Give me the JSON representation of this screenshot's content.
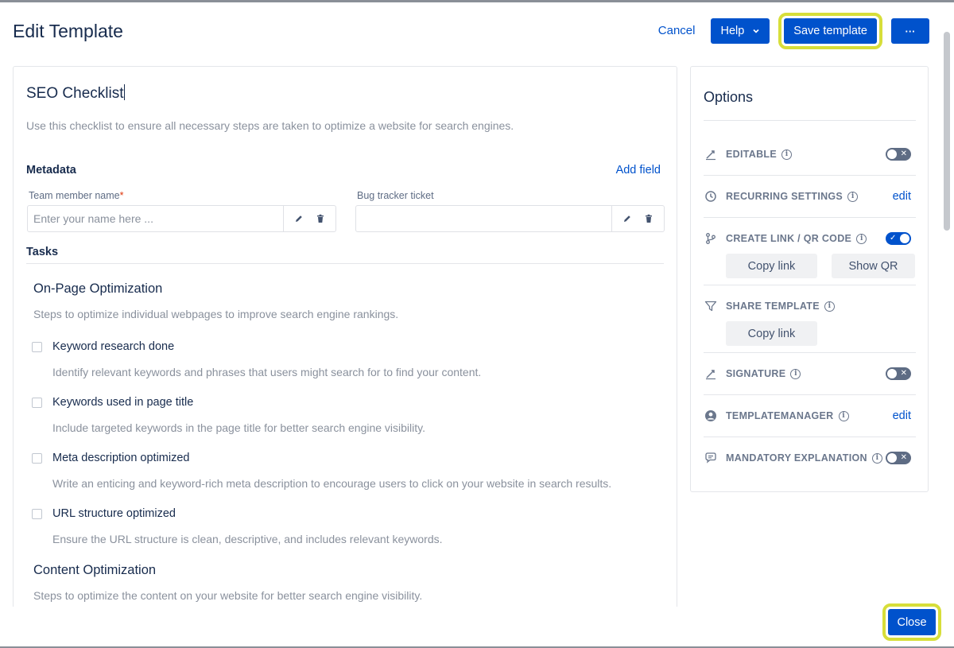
{
  "header": {
    "title": "Edit Template",
    "cancel_label": "Cancel",
    "help_label": "Help",
    "save_label": "Save template",
    "more_label": "···"
  },
  "checklist": {
    "title": "SEO Checklist",
    "description": "Use this checklist to ensure all necessary steps are taken to optimize a website for search engines."
  },
  "metadata": {
    "label": "Metadata",
    "add_field_label": "Add field",
    "fields": [
      {
        "label": "Team member name",
        "required_mark": "*",
        "placeholder": "Enter your name here ...",
        "value": ""
      },
      {
        "label": "Bug tracker ticket",
        "placeholder": "",
        "value": ""
      }
    ]
  },
  "tasks": {
    "label": "Tasks",
    "groups": [
      {
        "title": "On-Page Optimization",
        "description": "Steps to optimize individual webpages to improve search engine rankings.",
        "items": [
          {
            "name": "Keyword research done",
            "description": "Identify relevant keywords and phrases that users might search for to find your content."
          },
          {
            "name": "Keywords used in page title",
            "description": "Include targeted keywords in the page title for better search engine visibility."
          },
          {
            "name": "Meta description optimized",
            "description": "Write an enticing and keyword-rich meta description to encourage users to click on your website in search results."
          },
          {
            "name": "URL structure optimized",
            "description": "Ensure the URL structure is clean, descriptive, and includes relevant keywords."
          }
        ]
      },
      {
        "title": "Content Optimization",
        "description": "Steps to optimize the content on your website for better search engine visibility."
      }
    ]
  },
  "options": {
    "title": "Options",
    "info_glyph": "i",
    "toggle_off_mark": "✕",
    "toggle_on_mark": "✓",
    "edit_label": "edit",
    "rows": {
      "editable": {
        "label": "EDITABLE",
        "enabled": false,
        "icon": "signature-pen-icon"
      },
      "recurring": {
        "label": "RECURRING SETTINGS",
        "icon": "clock-icon"
      },
      "link_qr": {
        "label": "CREATE LINK / QR CODE",
        "enabled": true,
        "icon": "branch-icon",
        "copy_label": "Copy link",
        "qr_label": "Show QR"
      },
      "share": {
        "label": "SHARE TEMPLATE",
        "icon": "filter-funnel-icon",
        "copy_label": "Copy link"
      },
      "signature": {
        "label": "SIGNATURE",
        "enabled": false,
        "icon": "signature-pen-icon"
      },
      "manager": {
        "label": "TEMPLATEMANAGER",
        "icon": "user-circle-icon"
      },
      "mandatory": {
        "label": "MANDATORY EXPLANATION",
        "enabled": false,
        "icon": "speech-bubble-icon"
      }
    }
  },
  "footer": {
    "close_label": "Close"
  },
  "colors": {
    "primary": "#0052cc",
    "highlight": "#d7de3a",
    "text": "#172b4d",
    "muted": "#8a919d"
  }
}
